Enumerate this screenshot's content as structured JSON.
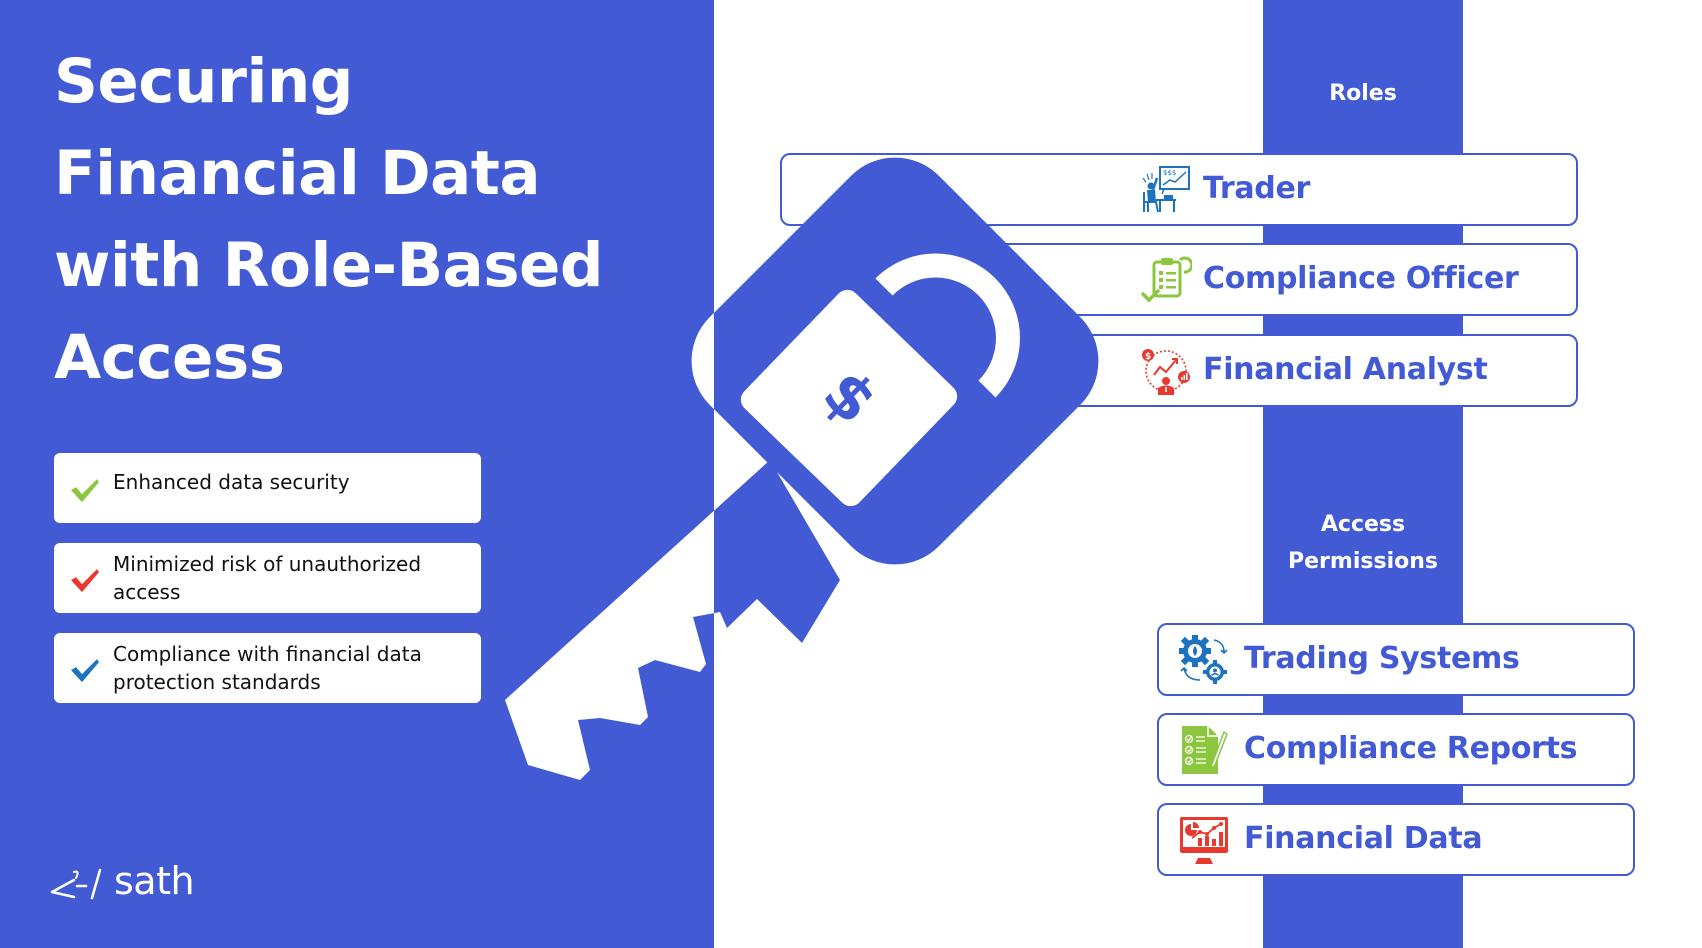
{
  "title": "Securing\nFinancial Data\nwith Role-Based\nAccess",
  "benefits": [
    {
      "text": "Enhanced data security",
      "check_color": "#8cc63f",
      "icon": "check-icon"
    },
    {
      "text": "Minimized risk of unauthorized access",
      "check_color": "#e8392f",
      "icon": "check-icon"
    },
    {
      "text": "Compliance with financial data protection standards",
      "check_color": "#1e73be",
      "icon": "check-icon"
    }
  ],
  "logo": {
    "text": "sath",
    "icon": "sath-logo-mark-icon"
  },
  "roles": {
    "label": "Roles",
    "items": [
      {
        "label": "Trader",
        "icon": "trader-icon",
        "icon_color": "#1e73be"
      },
      {
        "label": "Compliance Officer",
        "icon": "clipboard-checklist-icon",
        "icon_color": "#8cc63f"
      },
      {
        "label": "Financial Analyst",
        "icon": "analyst-chart-icon",
        "icon_color": "#e8392f"
      }
    ]
  },
  "permissions": {
    "label": "Access Permissions",
    "items": [
      {
        "label": "Trading Systems",
        "icon": "gears-cycle-icon",
        "icon_color": "#1e73be"
      },
      {
        "label": "Compliance Reports",
        "icon": "report-document-icon",
        "icon_color": "#8cc63f"
      },
      {
        "label": "Financial Data",
        "icon": "monitor-chart-icon",
        "icon_color": "#e8392f"
      }
    ]
  },
  "colors": {
    "brand_blue": "#425bd5",
    "white": "#ffffff"
  },
  "key_graphic": {
    "icon": "key-padlock-dollar-icon",
    "symbol": "$"
  }
}
